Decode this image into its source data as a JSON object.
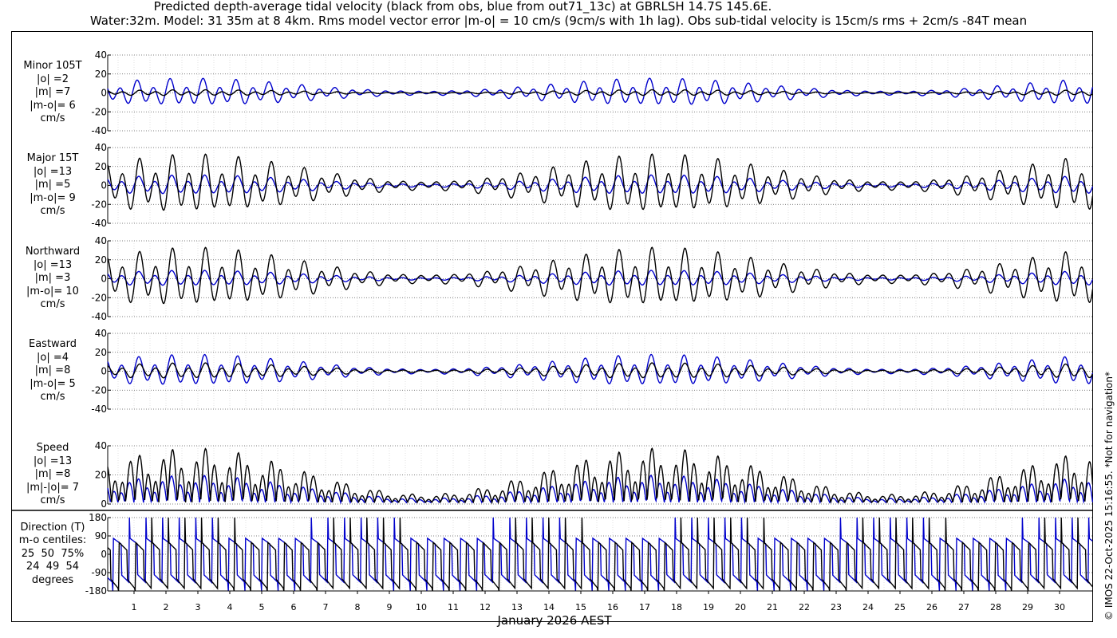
{
  "title_line1": "Predicted depth-average tidal velocity (black from obs, blue from out71_13c) at GBRLSH 14.7S 145.6E.",
  "title_line2": "Water:32m. Model: 31 35m at 8 4km. Rms model vector error |m-o| = 10 cm/s (9cm/s with 1h lag). Obs sub-tidal velocity is 15cm/s rms + 2cm/s -84T mean",
  "copyright": "© IMOS 22-Oct-2025 15:16:55. *Not for navigation*",
  "xlabel": "January 2026 AEST",
  "colors": {
    "obs": "#000000",
    "model": "#0000cc"
  },
  "panels": [
    {
      "label": "Minor 105T\n|o| =2\n|m| =7\n|m-o|= 6\ncm/s",
      "yticks": [
        "40",
        "20",
        "0",
        "-20",
        "-40"
      ]
    },
    {
      "label": "Major 15T\n|o| =13\n|m| =5\n|m-o|= 9\ncm/s",
      "yticks": [
        "40",
        "20",
        "0",
        "-20",
        "-40"
      ]
    },
    {
      "label": "Northward\n|o| =13\n|m| =3\n|m-o|= 10\ncm/s",
      "yticks": [
        "40",
        "20",
        "0",
        "-20",
        "-40"
      ]
    },
    {
      "label": "Eastward\n|o| =4\n|m| =8\n|m-o|= 5\ncm/s",
      "yticks": [
        "40",
        "20",
        "0",
        "-20",
        "-40"
      ]
    },
    {
      "label": "Speed\n|o| =13\n|m| =8\n|m|-|o|= 7\ncm/s",
      "yticks": [
        "40",
        "20",
        "0"
      ]
    },
    {
      "label": "Direction (T)\nm-o centiles:\n25  50  75%\n24  49  54\ndegrees",
      "yticks": [
        "180",
        "90",
        "0",
        "-90",
        "-180"
      ]
    }
  ],
  "chart_data": {
    "type": "line",
    "x_ticks": [
      "1",
      "2",
      "3",
      "4",
      "5",
      "6",
      "7",
      "8",
      "9",
      "10",
      "11",
      "12",
      "13",
      "14",
      "15",
      "16",
      "17",
      "18",
      "19",
      "20",
      "21",
      "22",
      "23",
      "24",
      "25",
      "26",
      "27",
      "28",
      "29",
      "30"
    ],
    "x_unit": "day of January 2026",
    "grid": true,
    "series": [
      {
        "name": "obs",
        "color": "#000000"
      },
      {
        "name": "model",
        "color": "#0000cc"
      }
    ],
    "panels": [
      {
        "name": "Minor 105T",
        "ylim": [
          -40,
          40
        ],
        "obs_amp": 3,
        "model_amp": 14
      },
      {
        "name": "Major 15T",
        "ylim": [
          -40,
          40
        ],
        "obs_amp": 30,
        "model_amp": 10
      },
      {
        "name": "Northward",
        "ylim": [
          -40,
          40
        ],
        "obs_amp": 30,
        "model_amp": 8
      },
      {
        "name": "Eastward",
        "ylim": [
          -40,
          40
        ],
        "obs_amp": 8,
        "model_amp": 16
      },
      {
        "name": "Speed",
        "ylim": [
          0,
          40
        ],
        "obs_amp": 36,
        "model_amp": 18
      },
      {
        "name": "Direction (T)",
        "ylim": [
          -180,
          180
        ]
      }
    ]
  }
}
